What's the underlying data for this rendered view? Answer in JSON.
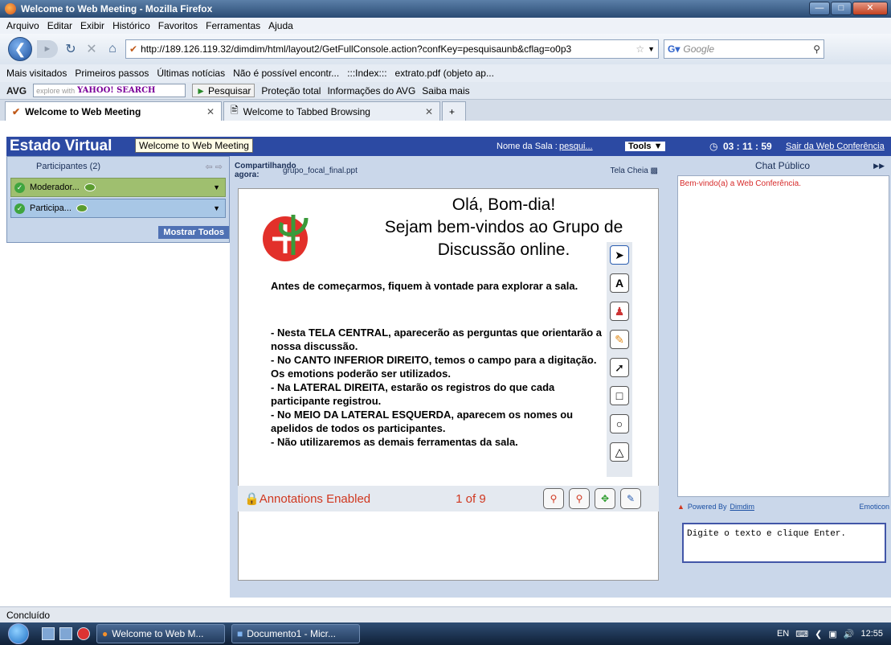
{
  "window": {
    "title": "Welcome to Web Meeting - Mozilla Firefox"
  },
  "menu": [
    "Arquivo",
    "Editar",
    "Exibir",
    "Histórico",
    "Favoritos",
    "Ferramentas",
    "Ajuda"
  ],
  "nav": {
    "url": "http://189.126.119.32/dimdim/html/layout2/GetFullConsole.action?confKey=pesquisaunb&cflag=o0p3",
    "search_placeholder": "Google"
  },
  "bookmarks": [
    "Mais visitados",
    "Primeiros passos",
    "Últimas notícias",
    "Não é possível encontr...",
    ":::Index:::",
    "extrato.pdf (objeto ap..."
  ],
  "avgbar": {
    "brand": "AVG",
    "search_placeholder": "explore with",
    "search_brand": "YAHOO! SEARCH",
    "pesquisar": "Pesquisar",
    "protecao": "Proteção total",
    "info": "Informações do AVG",
    "saiba": "Saiba mais"
  },
  "tabs": [
    {
      "label": "Welcome to Web Meeting",
      "active": true
    },
    {
      "label": "Welcome to Tabbed Browsing",
      "active": false
    }
  ],
  "app": {
    "brand": "Estado Virtual",
    "tooltip": "Welcome to Web Meeting",
    "room_label": "Nome da Sala :",
    "room_name": "pesqui...",
    "tools": "Tools",
    "timer": "03 : 11 : 59",
    "exit": "Sair da Web Conferência"
  },
  "participants": {
    "title": "Participantes (2)",
    "items": [
      {
        "name": "Moderador...",
        "type": "mod"
      },
      {
        "name": "Participa...",
        "type": "par"
      }
    ],
    "show_all": "Mostrar Todos"
  },
  "presentation": {
    "sharing_label": "Compartilhando agora:",
    "file": "grupo_focal_final.ppt",
    "fullscreen": "Tela Cheia",
    "title_lines": [
      "Olá, Bom-dia!",
      "Sejam bem-vindos ao Grupo de",
      "Discussão online."
    ],
    "body": [
      "Antes de começarmos, fiquem à vontade para explorar a sala.",
      "- Nesta TELA CENTRAL, aparecerão as perguntas que orientarão a nossa discussão.",
      "- No CANTO INFERIOR DIREITO, temos o campo para a digitação. Os emotions poderão ser utilizados.",
      "- Na LATERAL DIREITA, estarão os registros do que cada participante registrou.",
      "- No MEIO DA LATERAL ESQUERDA, aparecem os nomes ou apelidos de todos os participantes.",
      "- Não utilizaremos as demais ferramentas da sala."
    ],
    "annotations": "Annotations Enabled",
    "page": "1 of 9"
  },
  "chat": {
    "title": "Chat Público",
    "welcome": "Bem-vindo(a) a Web Conferência.",
    "powered": "Powered By",
    "powered_link": "Dimdim",
    "emoticon": "Emoticon",
    "input": "Digite o texto e clique Enter."
  },
  "status": "Concluído",
  "taskbar": {
    "items": [
      "Welcome to Web M...",
      "Documento1 - Micr..."
    ],
    "lang": "EN",
    "clock": "12:55"
  }
}
